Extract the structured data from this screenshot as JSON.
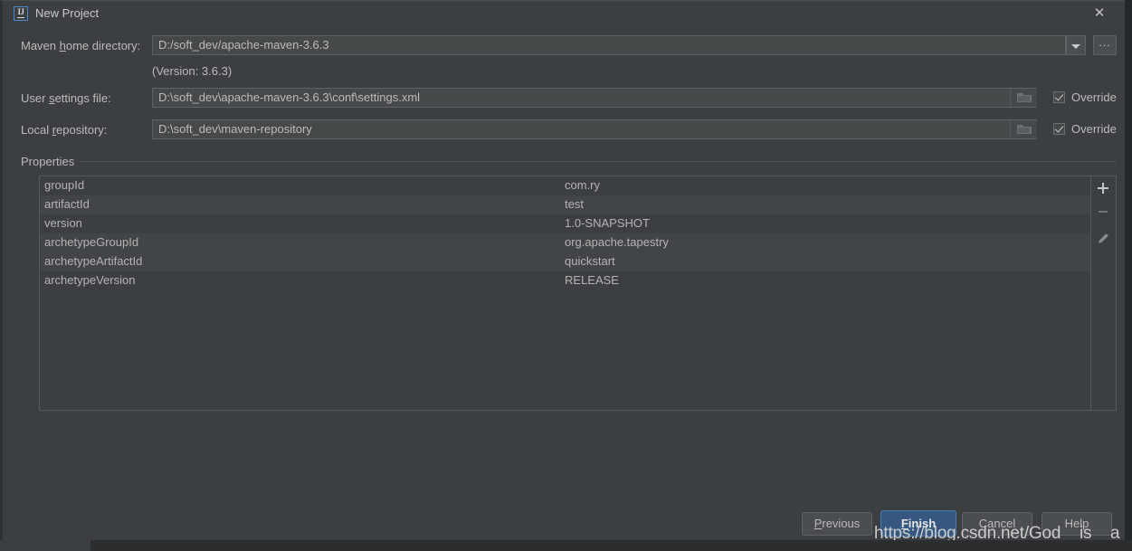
{
  "window": {
    "title": "New Project",
    "app_icon": "intellij-idea-icon",
    "close_icon": "close-icon"
  },
  "form": {
    "maven_home": {
      "label_before": "Maven ",
      "label_mnemonic": "h",
      "label_after": "ome directory:",
      "value": "D:/soft_dev/apache-maven-3.6.3",
      "dropdown_icon": "chevron-down-icon",
      "browse_label": "...",
      "version_note": "(Version: 3.6.3)"
    },
    "user_settings": {
      "label_before": "User ",
      "label_mnemonic": "s",
      "label_after": "ettings file:",
      "value": "D:\\soft_dev\\apache-maven-3.6.3\\conf\\settings.xml",
      "folder_icon": "folder-icon",
      "override_label": "Override",
      "override_checked": true
    },
    "local_repository": {
      "label_before": "Local ",
      "label_mnemonic": "r",
      "label_after": "epository:",
      "value": "D:\\soft_dev\\maven-repository",
      "folder_icon": "folder-icon",
      "override_label": "Override",
      "override_checked": true
    }
  },
  "properties": {
    "group_label": "Properties",
    "rows": [
      {
        "key": "groupId",
        "value": "com.ry"
      },
      {
        "key": "artifactId",
        "value": "test"
      },
      {
        "key": "version",
        "value": "1.0-SNAPSHOT"
      },
      {
        "key": "archetypeGroupId",
        "value": "org.apache.tapestry"
      },
      {
        "key": "archetypeArtifactId",
        "value": "quickstart"
      },
      {
        "key": "archetypeVersion",
        "value": "RELEASE"
      }
    ],
    "toolbar": {
      "add_icon": "plus-icon",
      "remove_icon": "minus-icon",
      "edit_icon": "pencil-icon"
    }
  },
  "buttons": {
    "previous": {
      "label_before": "",
      "label_mnemonic": "P",
      "label_after": "revious"
    },
    "finish": {
      "label_before": "",
      "label_mnemonic": "F",
      "label_after": "inish"
    },
    "cancel": {
      "label": "Cancel"
    },
    "help": {
      "label": "Help"
    }
  },
  "watermark": {
    "text": "https://blog.csdn.net/God__is__a__girl"
  },
  "colors": {
    "background": "#3c3f41",
    "field_background": "#45494a",
    "accent_blue": "#365880",
    "text": "#bbbbbb"
  }
}
